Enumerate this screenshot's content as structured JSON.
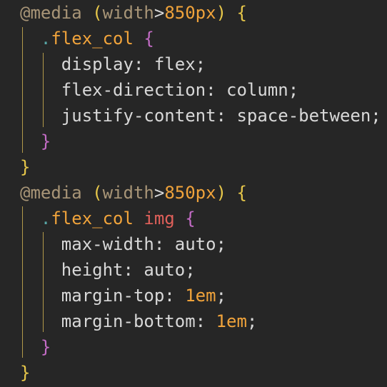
{
  "code": {
    "blocks": [
      {
        "at": "@",
        "keyword": "media",
        "paren_open": "(",
        "feature": "width",
        "operator": ">",
        "number": "850",
        "unit": "px",
        "paren_close": ")",
        "brace_open": "{",
        "rule": {
          "dot": ".",
          "class": "flex_col",
          "tag": "",
          "brace_open": "{",
          "declarations": [
            {
              "prop": "display",
              "colon": ":",
              "value": "flex",
              "num": "",
              "semi": ";"
            },
            {
              "prop": "flex-direction",
              "colon": ":",
              "value": "column",
              "num": "",
              "semi": ";"
            },
            {
              "prop": "justify-content",
              "colon": ":",
              "value": "space-between",
              "num": "",
              "semi": ";"
            }
          ],
          "brace_close": "}"
        },
        "brace_close": "}"
      },
      {
        "at": "@",
        "keyword": "media",
        "paren_open": "(",
        "feature": "width",
        "operator": ">",
        "number": "850",
        "unit": "px",
        "paren_close": ")",
        "brace_open": "{",
        "rule": {
          "dot": ".",
          "class": "flex_col",
          "tag": "img",
          "brace_open": "{",
          "declarations": [
            {
              "prop": "max-width",
              "colon": ":",
              "value": "auto",
              "num": "",
              "semi": ";"
            },
            {
              "prop": "height",
              "colon": ":",
              "value": "auto",
              "num": "",
              "semi": ";"
            },
            {
              "prop": "margin-top",
              "colon": ":",
              "value": "",
              "num": "1em",
              "semi": ";"
            },
            {
              "prop": "margin-bottom",
              "colon": ":",
              "value": "",
              "num": "1em",
              "semi": ";"
            }
          ],
          "brace_close": "}"
        },
        "brace_close": "}"
      }
    ]
  }
}
